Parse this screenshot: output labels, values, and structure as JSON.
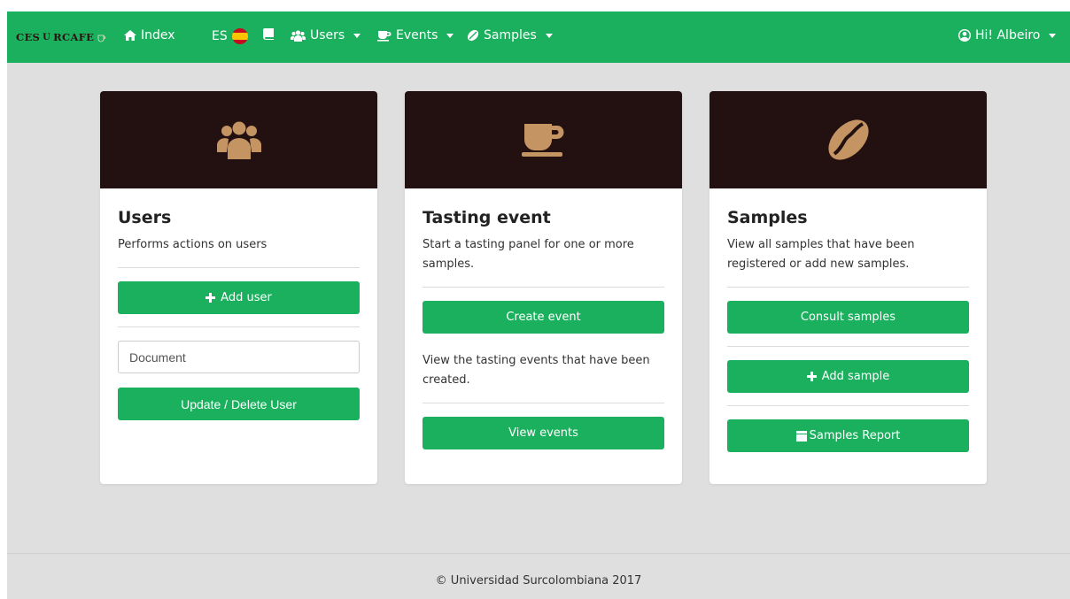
{
  "navbar": {
    "brand": "CES",
    "brand_rest": "RCAFE",
    "brand_u": "U",
    "index_label": "Index",
    "lang_label": "ES",
    "users_label": "Users",
    "events_label": "Events",
    "samples_label": "Samples",
    "user_greeting": "Hi! Albeiro"
  },
  "cards": {
    "users": {
      "title": "Users",
      "description": "Performs actions on users",
      "add_button": "Add user",
      "document_placeholder": "Document",
      "update_button": "Update / Delete User"
    },
    "tasting": {
      "title": "Tasting event",
      "description": "Start a tasting panel for one or more samples.",
      "create_button": "Create event",
      "view_description": "View the tasting events that have been created.",
      "view_button": "View events"
    },
    "samples": {
      "title": "Samples",
      "description": "View all samples that have been registered or add new samples.",
      "consult_button": "Consult samples",
      "add_button": "Add sample",
      "report_button": "Samples Report"
    }
  },
  "footer": {
    "text": "© Universidad Surcolombiana 2017"
  },
  "colors": {
    "accent": "#1bb05e",
    "card_header": "#231010",
    "icon": "#c49463",
    "background": "#e0dfdf"
  }
}
